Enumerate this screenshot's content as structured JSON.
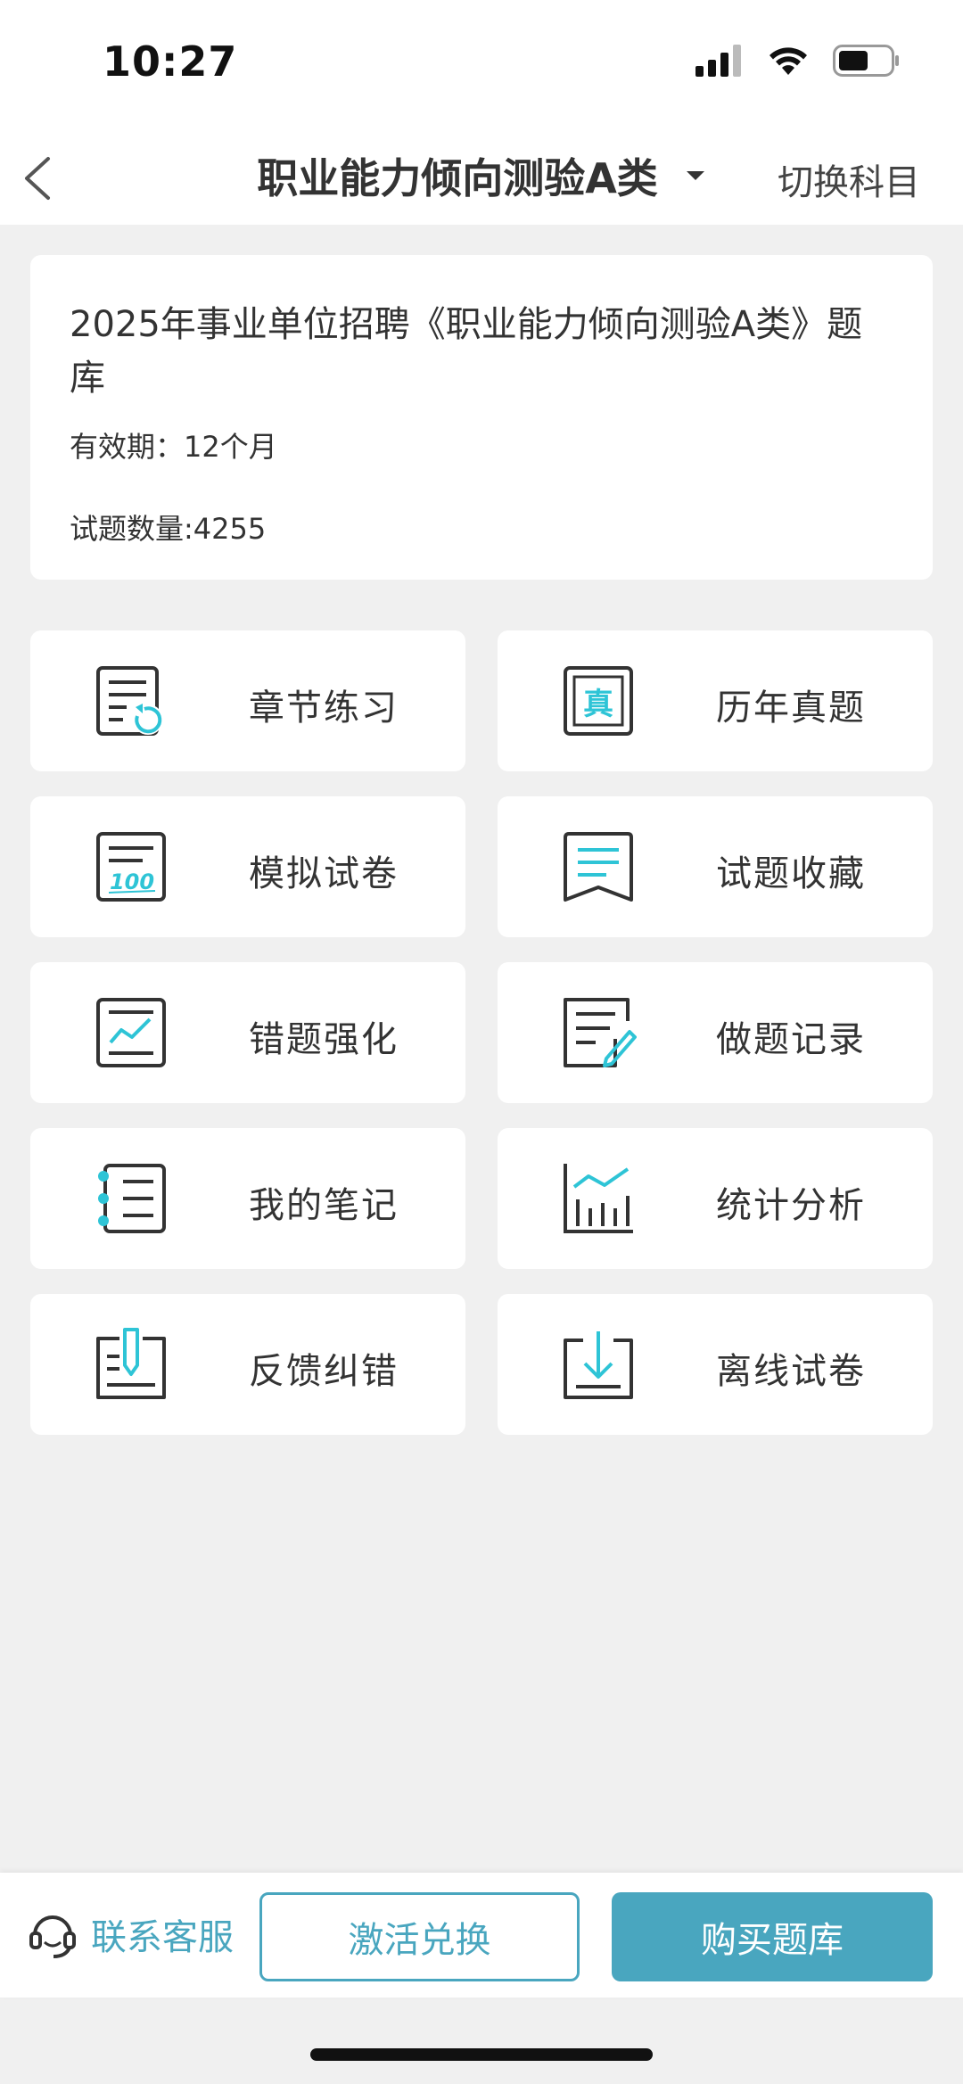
{
  "status_bar": {
    "time": "10:27"
  },
  "nav": {
    "title": "职业能力倾向测验A类",
    "switch_label": "切换科目"
  },
  "card": {
    "title": "2025年事业单位招聘《职业能力倾向测验A类》题库",
    "validity": "有效期：12个月",
    "question_count": "试题数量:4255"
  },
  "menu": [
    {
      "label": "章节练习",
      "icon": "chapter-practice-icon"
    },
    {
      "label": "历年真题",
      "icon": "past-papers-icon"
    },
    {
      "label": "模拟试卷",
      "icon": "mock-exam-icon"
    },
    {
      "label": "试题收藏",
      "icon": "favorites-icon"
    },
    {
      "label": "错题强化",
      "icon": "wrong-questions-icon"
    },
    {
      "label": "做题记录",
      "icon": "practice-record-icon"
    },
    {
      "label": "我的笔记",
      "icon": "notes-icon"
    },
    {
      "label": "统计分析",
      "icon": "statistics-icon"
    },
    {
      "label": "反馈纠错",
      "icon": "feedback-icon"
    },
    {
      "label": "离线试卷",
      "icon": "offline-download-icon"
    }
  ],
  "bottom_bar": {
    "customer_service": "联系客服",
    "activate": "激活兑换",
    "buy": "购买题库"
  },
  "colors": {
    "accent": "#49a6bf",
    "icon_accent": "#2ec4d6",
    "icon_stroke": "#333333",
    "background": "#f0f0f0"
  }
}
